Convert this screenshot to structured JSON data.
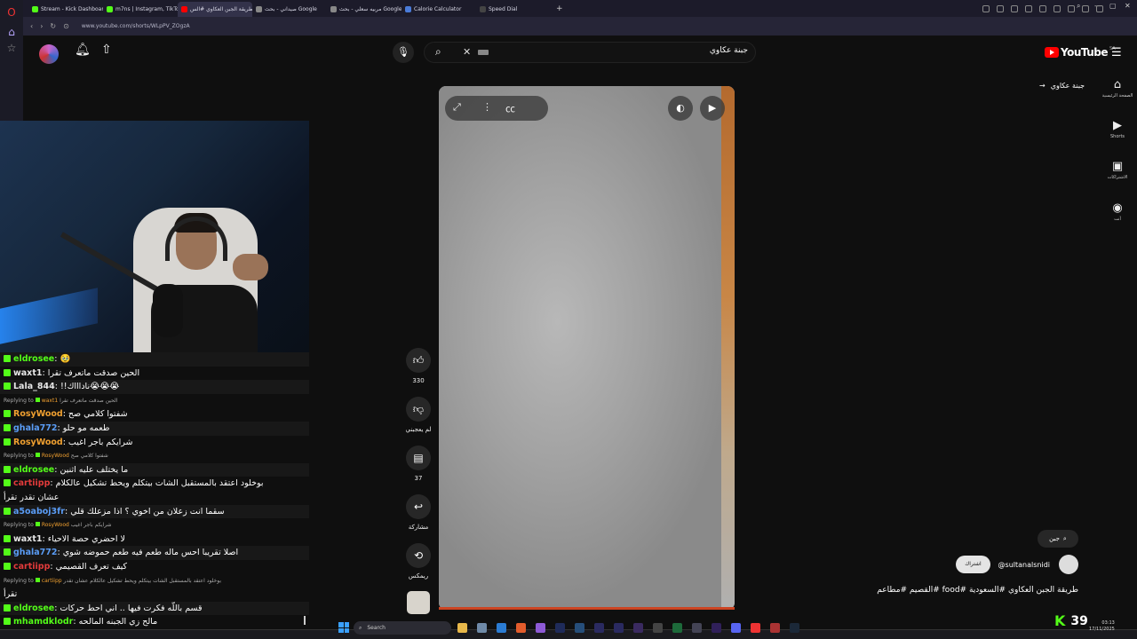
{
  "browser": {
    "tabs": [
      {
        "label": "Stream - Kick Dashboard",
        "color": "#53fc18"
      },
      {
        "label": "m7ns | Instagram, TikTok |",
        "color": "#53fc18"
      },
      {
        "label": "طريقة الجبن العكاوي #الس",
        "color": "#ff0000"
      },
      {
        "label": "صيداني - بحث Google",
        "color": "#888888"
      },
      {
        "label": "مربيه سعلي - بحث Google",
        "color": "#888888"
      },
      {
        "label": "Calorie Calculator",
        "color": "#4a7bd8"
      },
      {
        "label": "Speed Dial",
        "color": "#444444"
      }
    ],
    "new_tab": "+",
    "url": "www.youtube.com/shorts/WLpPV_ZOgzA"
  },
  "youtube": {
    "search_query": "جبنة عكاوي",
    "logo_word": "YouTube",
    "region": "SA",
    "back_label": "جبنة عكاوي",
    "nav": [
      {
        "icon": "⌂",
        "label": "الصفحة الرئيسية"
      },
      {
        "icon": "▶",
        "label": "Shorts"
      },
      {
        "icon": "▣",
        "label": "الاشتراكات"
      },
      {
        "icon": "◉",
        "label": "أنت"
      }
    ],
    "actions": {
      "like_count": "330",
      "dislike_label": "لم يعجبني",
      "comments_count": "37",
      "share_label": "مشاركة",
      "remix_label": "ريمكس"
    },
    "search_chip": "جبن",
    "channel_name": "@sultanalsnidi",
    "subscribe_label": "اشتراك",
    "video_title": "طريقة الجبن العكاوي #السعودية #food #القصيم #مطاعم"
  },
  "chat": {
    "entries": [
      {
        "type": "msg",
        "user": "eldrosee",
        "color": "#53fc18",
        "text": "🥹"
      },
      {
        "type": "msg",
        "user": "waxt1",
        "color": "#e8e8e8",
        "text": "الحين صدقت ماتعرف تقرا"
      },
      {
        "type": "msg",
        "user": "Lala_844",
        "color": "#e8e8e8",
        "text": "!!ناداااك😭😭😭"
      },
      {
        "type": "reply",
        "label": "Replying to",
        "user": "waxt1",
        "text": "الحين صدقت ماتعرف تقرا"
      },
      {
        "type": "msg",
        "user": "RosyWood",
        "color": "#f0a030",
        "text": "شفتوا كلامي صح"
      },
      {
        "type": "msg",
        "user": "ghala772",
        "color": "#5a9cf5",
        "text": "طعمه مو حلو"
      },
      {
        "type": "msg",
        "user": "RosyWood",
        "color": "#f0a030",
        "text": "شرايكم باجر اغيب"
      },
      {
        "type": "reply",
        "label": "Replying to",
        "user": "RosyWood",
        "text": "شفتوا كلامي صح"
      },
      {
        "type": "msg",
        "user": "eldrosee",
        "color": "#53fc18",
        "text": "ما يختلف عليه اثنين"
      },
      {
        "type": "msg",
        "user": "cartiipp",
        "color": "#e23b3b",
        "text": "بوخلود اعتقد بالمستقبل الشات بيتكلم ويحط تشكيل عالكلام"
      },
      {
        "type": "cont",
        "text": "عشان تقدر تقرأ"
      },
      {
        "type": "msg",
        "user": "a5oaboj3fr",
        "color": "#5a9cf5",
        "text": "سقما انت زعلان من اخوي ؟ اذا مزعلك قلي"
      },
      {
        "type": "reply",
        "label": "Replying to",
        "user": "RosyWood",
        "text": "شرايكم باجر اغيب"
      },
      {
        "type": "msg",
        "user": "waxt1",
        "color": "#e8e8e8",
        "text": "لا احضري حصة الاحياء"
      },
      {
        "type": "msg",
        "user": "ghala772",
        "color": "#5a9cf5",
        "text": "اصلا تقريبا احس ماله طعم فيه طعم حموضه شوي"
      },
      {
        "type": "msg",
        "user": "cartiipp",
        "color": "#e23b3b",
        "text": "كيف تعرف القصيمي"
      },
      {
        "type": "reply",
        "label": "Replying to",
        "user": "cartiipp",
        "text": "بوخلود اعتقد بالمستقبل الشات بيتكلم ويحط تشكيل عالكلام عشان تقدر"
      },
      {
        "type": "cont",
        "text": "تقرأ"
      },
      {
        "type": "msg",
        "user": "eldrosee",
        "color": "#53fc18",
        "text": "قسم باللّه فكرت فيها .. اني احط حركات"
      },
      {
        "type": "msg",
        "user": "mhamdklodr",
        "color": "#53fc18",
        "text": "مالح زي الجبنه المالحه"
      }
    ]
  },
  "kick": {
    "viewer_count": "39"
  },
  "taskbar": {
    "search_placeholder": "Search",
    "time": "03:13",
    "date": "17/11/2025"
  }
}
